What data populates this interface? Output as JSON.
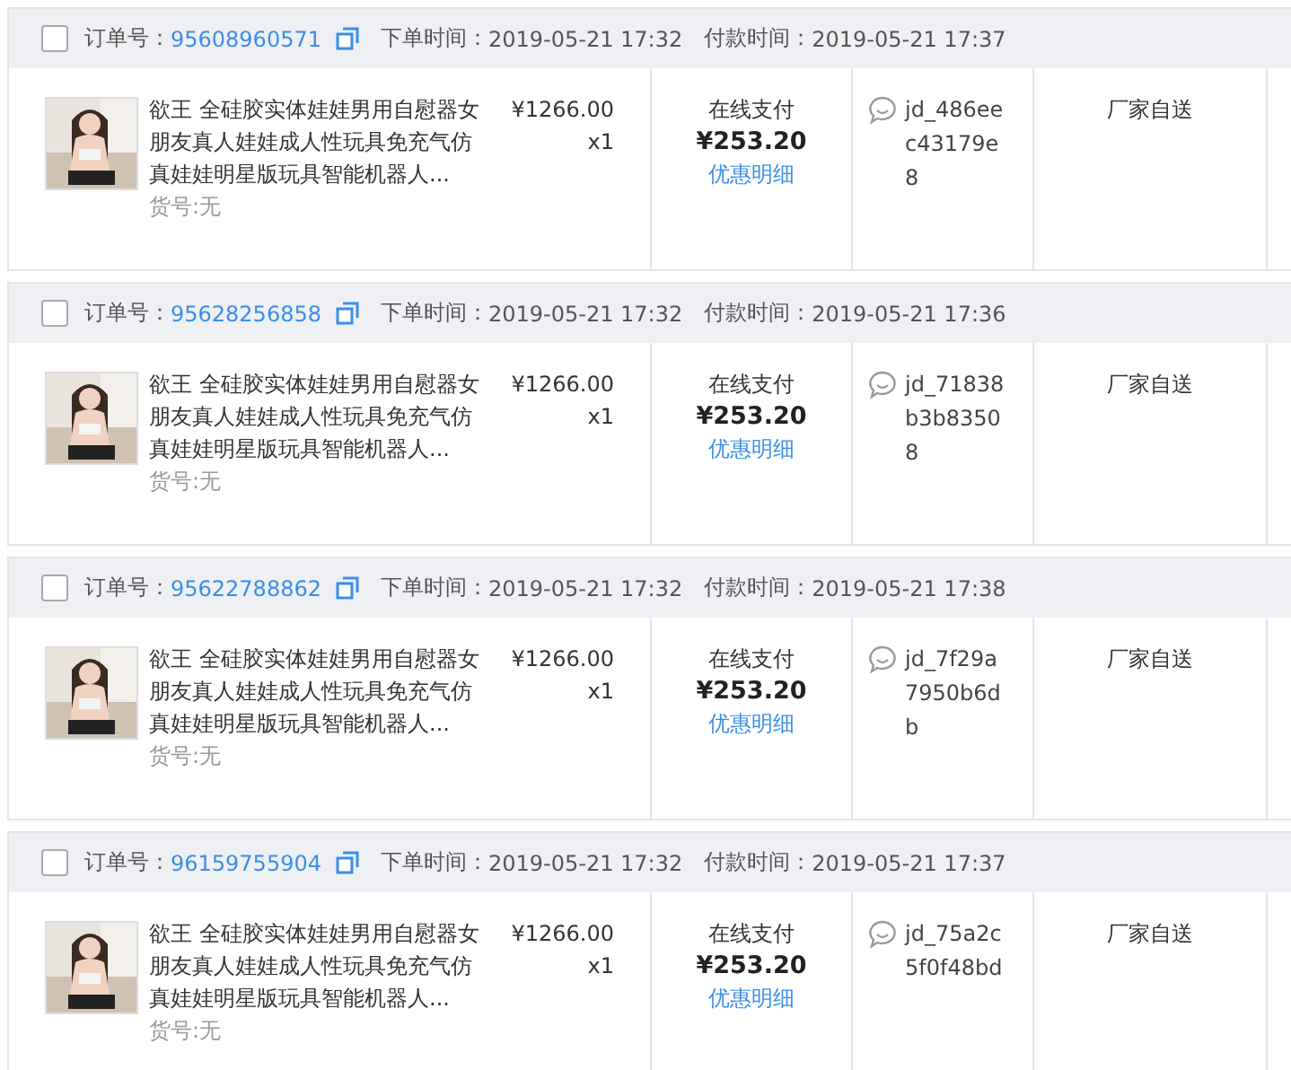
{
  "orders": [
    {
      "checked": false,
      "order_label": "订单号：",
      "order_no": "95608960571",
      "placed_label": "下单时间：",
      "placed_time": "2019-05-21 17:32",
      "paid_label": "付款时间：",
      "paid_time": "2019-05-21 17:37",
      "product": {
        "kind": "picture",
        "title": "欲王 全硅胶实体娃娃男用自慰器女朋友真人娃娃成人性玩具免充气仿真娃娃明星版玩具智能机器人...",
        "sku": "货号:无",
        "price": "¥1266.00",
        "qty": "x1"
      },
      "payment_method": "在线支付",
      "amount": "¥253.20",
      "discount_link": "优惠明细",
      "buyer": "jd_486eec43179e8",
      "delivery": "厂家自送"
    },
    {
      "checked": false,
      "order_label": "订单号：",
      "order_no": "95628256858",
      "placed_label": "下单时间：",
      "placed_time": "2019-05-21 17:32",
      "paid_label": "付款时间：",
      "paid_time": "2019-05-21 17:36",
      "product": {
        "kind": "picture",
        "title": "欲王 全硅胶实体娃娃男用自慰器女朋友真人娃娃成人性玩具免充气仿真娃娃明星版玩具智能机器人...",
        "sku": "货号:无",
        "price": "¥1266.00",
        "qty": "x1"
      },
      "payment_method": "在线支付",
      "amount": "¥253.20",
      "discount_link": "优惠明细",
      "buyer": "jd_71838b3b83508",
      "delivery": "厂家自送"
    },
    {
      "checked": false,
      "order_label": "订单号：",
      "order_no": "95622788862",
      "placed_label": "下单时间：",
      "placed_time": "2019-05-21 17:32",
      "paid_label": "付款时间：",
      "paid_time": "2019-05-21 17:38",
      "product": {
        "kind": "picture",
        "title": "欲王 全硅胶实体娃娃男用自慰器女朋友真人娃娃成人性玩具免充气仿真娃娃明星版玩具智能机器人...",
        "sku": "货号:无",
        "price": "¥1266.00",
        "qty": "x1"
      },
      "payment_method": "在线支付",
      "amount": "¥253.20",
      "discount_link": "优惠明细",
      "buyer": "jd_7f29a7950b6db",
      "delivery": "厂家自送"
    },
    {
      "checked": false,
      "order_label": "订单号：",
      "order_no": "96159755904",
      "placed_label": "下单时间：",
      "placed_time": "2019-05-21 17:32",
      "paid_label": "付款时间：",
      "paid_time": "2019-05-21 17:37",
      "product": {
        "kind": "picture",
        "title": "欲王 全硅胶实体娃娃男用自慰器女朋友真人娃娃成人性玩具免充气仿真娃娃明星版玩具智能机器人...",
        "sku": "货号:无",
        "price": "¥1266.00",
        "qty": "x1"
      },
      "payment_method": "在线支付",
      "amount": "¥253.20",
      "discount_link": "优惠明细",
      "buyer": "jd_75a2c5f0f48bd",
      "delivery": "厂家自送"
    }
  ]
}
